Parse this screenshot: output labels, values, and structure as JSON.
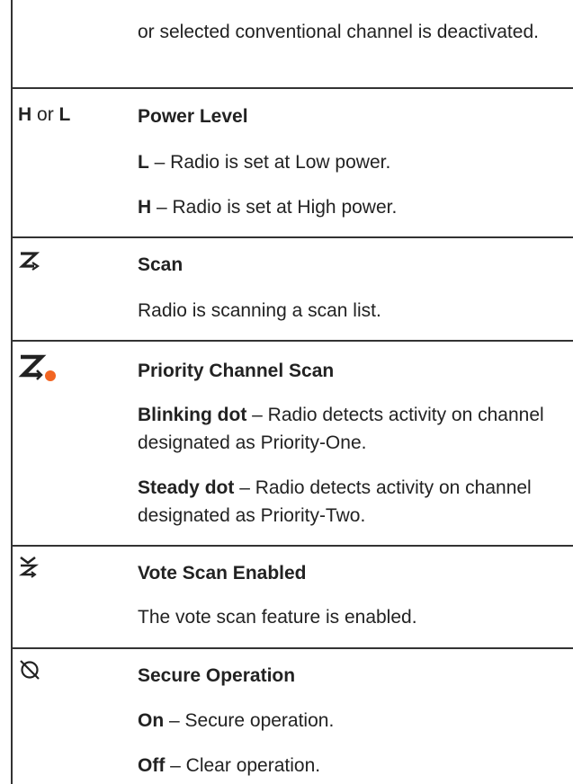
{
  "continuation": {
    "text": "or selected conventional channel is deactivated."
  },
  "power_level": {
    "icon_high": "H",
    "icon_connector": "or",
    "icon_low": "L",
    "title": "Power Level",
    "items": [
      {
        "term": "L",
        "desc": " – Radio is set at Low power."
      },
      {
        "term": "H",
        "desc": " – Radio is set at High power."
      }
    ]
  },
  "scan": {
    "icon": "scan-icon",
    "title": "Scan",
    "desc": "Radio is scanning a scan list."
  },
  "priority_scan": {
    "icon": "priority-channel-scan-icon",
    "dot_color": "#f26522",
    "title": "Priority Channel Scan",
    "items": [
      {
        "term": "Blinking dot",
        "desc": " – Radio detects activity on channel designated as Priority-One."
      },
      {
        "term": "Steady dot",
        "desc": " – Radio detects activity on channel designated as Priority-Two."
      }
    ]
  },
  "vote_scan": {
    "icon": "vote-scan-icon",
    "title": "Vote Scan Enabled",
    "desc": "The vote scan feature is enabled."
  },
  "secure": {
    "icon": "secure-operation-icon",
    "title": "Secure Operation",
    "items": [
      {
        "term": "On",
        "desc": " – Secure operation."
      },
      {
        "term": "Off",
        "desc": " – Clear operation."
      }
    ]
  }
}
